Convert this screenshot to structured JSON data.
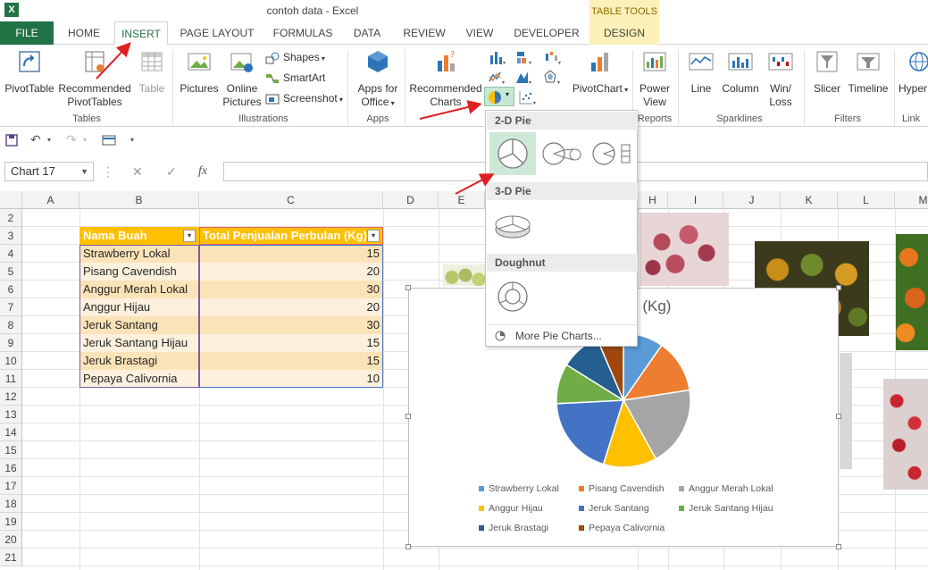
{
  "window": {
    "title": "contoh data - Excel",
    "app_logo": "X"
  },
  "contextual": {
    "header": "TABLE TOOLS",
    "tab": "DESIGN"
  },
  "tabs": [
    "FILE",
    "HOME",
    "INSERT",
    "PAGE LAYOUT",
    "FORMULAS",
    "DATA",
    "REVIEW",
    "VIEW",
    "DEVELOPER"
  ],
  "ribbon": {
    "tables": {
      "label": "Tables",
      "pivottable": "PivotTable",
      "recommended": [
        "Recommended",
        "PivotTables"
      ],
      "table": "Table"
    },
    "illustrations": {
      "label": "Illustrations",
      "pictures": "Pictures",
      "online": [
        "Online",
        "Pictures"
      ],
      "shapes": "Shapes",
      "smartart": "SmartArt",
      "screenshot": "Screenshot"
    },
    "apps": {
      "label": "Apps",
      "apps_for": [
        "Apps for",
        "Office"
      ]
    },
    "charts": {
      "recommended": [
        "Recommended",
        "Charts"
      ],
      "pivotchart": "PivotChart"
    },
    "reports": {
      "label": "Reports",
      "power_view": [
        "Power",
        "View"
      ]
    },
    "sparklines": {
      "label": "Sparklines",
      "line": "Line",
      "column": "Column",
      "winloss": [
        "Win/",
        "Loss"
      ]
    },
    "filters": {
      "label": "Filters",
      "slicer": "Slicer",
      "timeline": "Timeline"
    },
    "links": {
      "label": "Link",
      "hyper": "Hyper"
    }
  },
  "namebox": "Chart 17",
  "formula_bar": {
    "fx": "fx"
  },
  "columns": [
    "A",
    "B",
    "C",
    "D",
    "E",
    "H",
    "I",
    "J",
    "K",
    "L",
    "M"
  ],
  "rows": [
    "2",
    "3",
    "4",
    "5",
    "6",
    "7",
    "8",
    "9",
    "10",
    "11",
    "12",
    "13",
    "14",
    "15",
    "16",
    "17",
    "18",
    "19",
    "20",
    "21"
  ],
  "table": {
    "headers": [
      "Nama Buah",
      "Total Penjualan Perbulan (Kg)"
    ],
    "rows": [
      {
        "name": "Strawberry Lokal",
        "value": "15"
      },
      {
        "name": "Pisang Cavendish",
        "value": "20"
      },
      {
        "name": "Anggur Merah Lokal",
        "value": "30"
      },
      {
        "name": "Anggur Hijau",
        "value": "20"
      },
      {
        "name": "Jeruk Santang",
        "value": "30"
      },
      {
        "name": "Jeruk Santang Hijau",
        "value": "15"
      },
      {
        "name": "Jeruk Brastagi",
        "value": "15"
      },
      {
        "name": "Pepaya Calivornia",
        "value": "10"
      }
    ]
  },
  "dropdown": {
    "section_2d": "2-D Pie",
    "section_3d": "3-D Pie",
    "section_doughnut": "Doughnut",
    "more": "More Pie Charts..."
  },
  "chart_data": {
    "type": "pie",
    "title": "Perbulan (Kg)",
    "categories": [
      "Strawberry Lokal",
      "Pisang Cavendish",
      "Anggur Merah Lokal",
      "Anggur Hijau",
      "Jeruk Santang",
      "Jeruk Santang Hijau",
      "Jeruk Brastagi",
      "Pepaya Calivornia"
    ],
    "values": [
      15,
      20,
      30,
      20,
      30,
      15,
      15,
      10
    ],
    "colors": [
      "#5b9bd5",
      "#ed7d31",
      "#a5a5a5",
      "#ffc000",
      "#4472c4",
      "#70ad47",
      "#255e91",
      "#9e480e"
    ],
    "legend": "bottom"
  }
}
